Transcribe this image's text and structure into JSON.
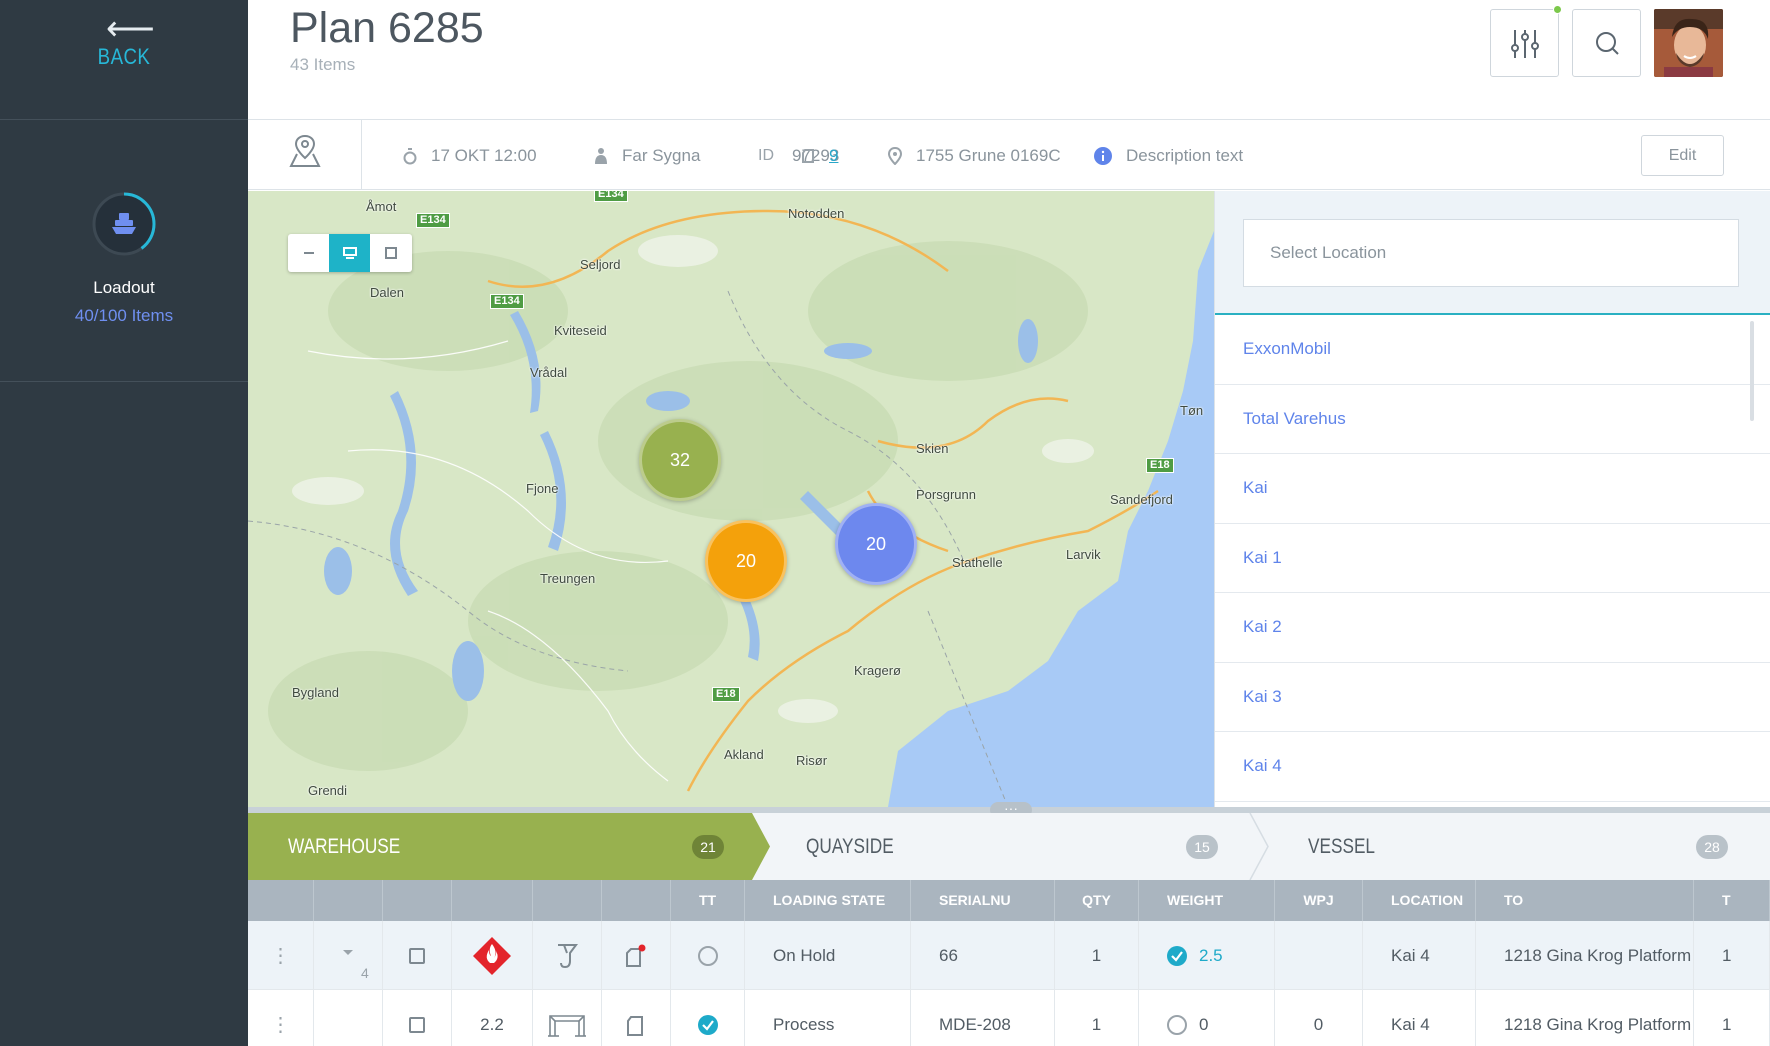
{
  "sidebar": {
    "back_label": "BACK",
    "loadout": {
      "title": "Loadout",
      "items": "40/100 Items",
      "progress": 0.4
    }
  },
  "header": {
    "title": "Plan 6285",
    "subtitle": "43 Items"
  },
  "info": {
    "datetime": "17 OKT 12:00",
    "person": "Far Sygna",
    "id_label": "ID",
    "id_value": "97293",
    "count": "9",
    "location": "1755 Grune 0169C",
    "description": "Description text",
    "edit_label": "Edit"
  },
  "map": {
    "labels": [
      "Åmot",
      "Notodden",
      "Seljord",
      "Dalen",
      "Kviteseid",
      "Vrådal",
      "Skien",
      "Porsgrunn",
      "Tøn",
      "Sandefjord",
      "Fjone",
      "Stathelle",
      "Larvik",
      "Treungen",
      "Kragerø",
      "Bygland",
      "Akland",
      "Risør",
      "Grendi"
    ],
    "routes": [
      "E134",
      "E134",
      "E134",
      "E18",
      "E18"
    ],
    "clusters": [
      {
        "count": "32",
        "color": "#98b14f"
      },
      {
        "count": "20",
        "color": "#f4a10b"
      },
      {
        "count": "20",
        "color": "#6d88ee"
      }
    ]
  },
  "locations": {
    "placeholder": "Select Location",
    "items": [
      "ExxonMobil",
      "Total Varehus",
      "Kai",
      "Kai 1",
      "Kai 2",
      "Kai 3",
      "Kai 4"
    ]
  },
  "stages": [
    {
      "label": "WAREHOUSE",
      "count": "21",
      "active": true
    },
    {
      "label": "QUAYSIDE",
      "count": "15",
      "active": false
    },
    {
      "label": "VESSEL",
      "count": "28",
      "active": false
    }
  ],
  "table": {
    "columns": [
      "TT",
      "LOADING STATE",
      "SERIALNU",
      "QTY",
      "WEIGHT",
      "WPJ",
      "LOCATION",
      "TO",
      "T"
    ],
    "rows": [
      {
        "expand_count": "4",
        "hazard_code": "",
        "tt_checked": false,
        "loading_state": "On Hold",
        "serial": "66",
        "qty": "1",
        "weight_checked": true,
        "weight": "2.5",
        "wpj": "",
        "location": "Kai 4",
        "to": "1218 Gina Krog Platform",
        "t": "1"
      },
      {
        "expand_count": "",
        "hazard_code": "2.2",
        "tt_checked": true,
        "loading_state": "Process",
        "serial": "MDE-208",
        "qty": "1",
        "weight_checked": false,
        "weight": "0",
        "wpj": "0",
        "location": "Kai 4",
        "to": "1218 Gina Krog Platform",
        "t": "1"
      }
    ]
  },
  "colors": {
    "sidebar": "#2f3a43",
    "accent": "#27b8d8",
    "warehouse": "#98b14f",
    "link": "#5f84ea"
  }
}
